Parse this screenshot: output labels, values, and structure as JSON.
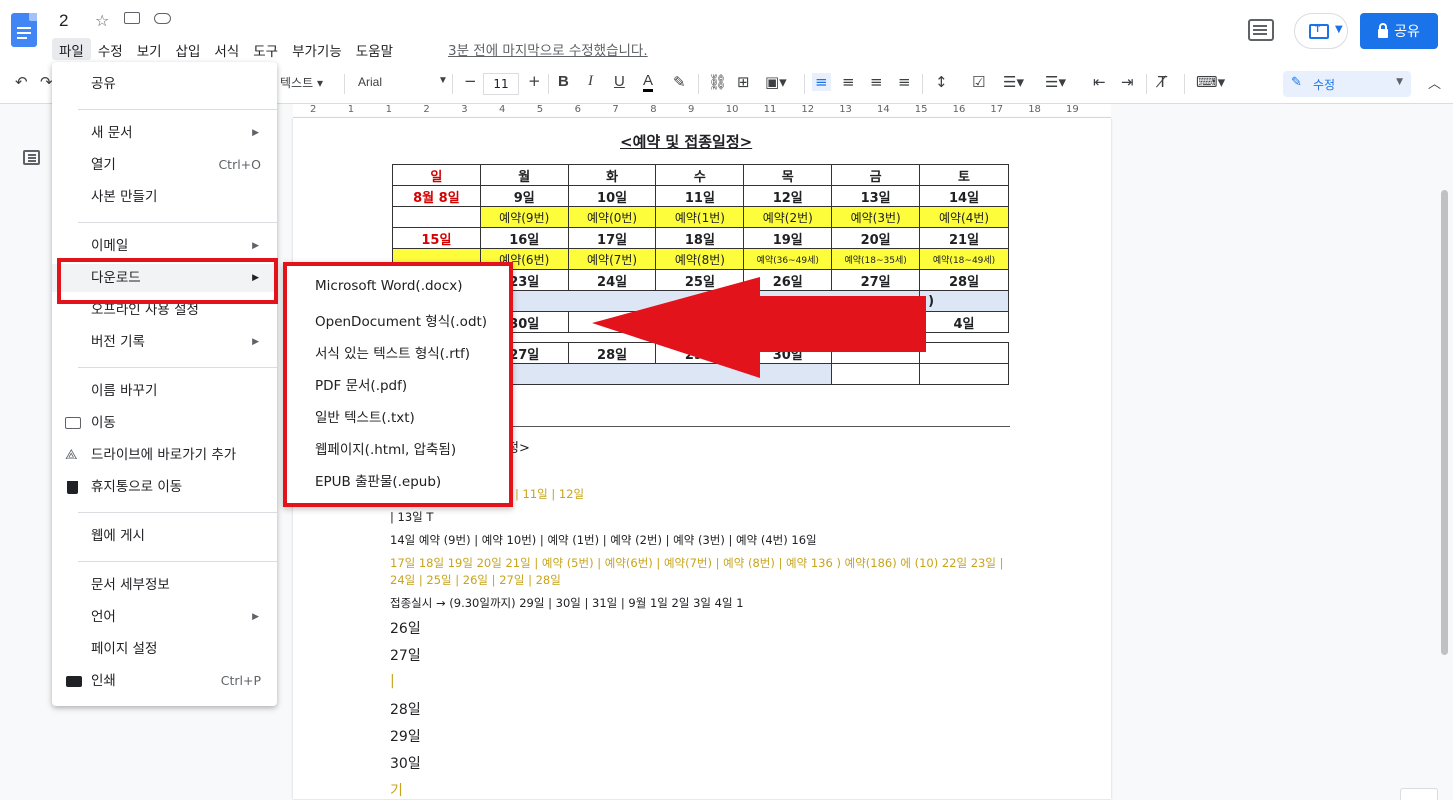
{
  "header": {
    "doc_title": "2",
    "menus": [
      "파일",
      "수정",
      "보기",
      "삽입",
      "서식",
      "도구",
      "부가기능",
      "도움말"
    ],
    "last_edit": "3분 전에 마지막으로 수정했습니다.",
    "share_label": "공유"
  },
  "toolbar": {
    "style_value": "텍스트",
    "font_value": "Arial",
    "font_size": "11",
    "mode_label": "수정"
  },
  "ruler": [
    "2",
    "1",
    "1",
    "2",
    "3",
    "4",
    "5",
    "6",
    "7",
    "8",
    "9",
    "10",
    "11",
    "12",
    "13",
    "14",
    "15",
    "16",
    "17",
    "18",
    "19"
  ],
  "file_menu": {
    "items": [
      {
        "label": "공유"
      },
      {
        "label": "새 문서"
      },
      {
        "label": "열기",
        "shortcut": "Ctrl+O"
      },
      {
        "label": "사본 만들기"
      },
      {
        "label": "이메일"
      },
      {
        "label": "다운로드"
      },
      {
        "label": "오프라인 사용 설정"
      },
      {
        "label": "버전 기록"
      },
      {
        "label": "이름 바꾸기"
      },
      {
        "label": "이동"
      },
      {
        "label": "드라이브에 바로가기 추가"
      },
      {
        "label": "휴지통으로 이동"
      },
      {
        "label": "웹에 게시"
      },
      {
        "label": "문서 세부정보"
      },
      {
        "label": "언어"
      },
      {
        "label": "페이지 설정"
      },
      {
        "label": "인쇄",
        "shortcut": "Ctrl+P"
      }
    ]
  },
  "download_menu": {
    "items": [
      "Microsoft Word(.docx)",
      "OpenDocument 형식(.odt)",
      "서식 있는 텍스트 형식(.rtf)",
      "PDF 문서(.pdf)",
      "일반 텍스트(.txt)",
      "웹페이지(.html, 압축됨)",
      "EPUB 출판물(.epub)"
    ]
  },
  "document": {
    "schedule_title": "<예약 및 접종일정>",
    "days": [
      "일",
      "월",
      "화",
      "수",
      "목",
      "금",
      "토"
    ],
    "row1": [
      "8월 8일",
      "9일",
      "10일",
      "11일",
      "12일",
      "13일",
      "14일"
    ],
    "row2": [
      "",
      "예약(9번)",
      "예약(0번)",
      "예약(1번)",
      "예약(2번)",
      "예약(3번)",
      "예약(4번)"
    ],
    "row3": [
      "15일",
      "16일",
      "17일",
      "18일",
      "19일",
      "20일",
      "21일"
    ],
    "row4": [
      "",
      "예약(6번)",
      "예약(7번)",
      "예약(8번)",
      "예약(36~49세)",
      "예약(18~35세)",
      "예약(18~49세)"
    ],
    "row5": [
      "",
      "23일",
      "24일",
      "25일",
      "26일",
      "27일",
      "28일"
    ],
    "row6_end": ")",
    "row7": [
      "",
      "30일",
      "",
      "",
      "",
      "",
      "4일"
    ],
    "row8": [
      "",
      "27일",
      "28일",
      "29일",
      "30일",
      "",
      ""
    ],
    "text_heading_tail": "정>",
    "line_olive1": "| 11일 | 12일",
    "line_13": "| 13일 T",
    "line_14": "14일 예약 (9번) | 예약 10번) | 예약 (1번) | 예약 (2번) | 예약 (3번) | 예약 (4번) 16일",
    "line_17": "17일 18일 19일 20일 21일 | 예약 (5번) | 예약(6번) | 예약(7번) | 예약 (8번) | 예약 136 ) 예약(186) 에 (10) 22일 23일 |",
    "line_24": "24일 | 25일 | 26일 | 27일 | 28일",
    "line_vax": "접종실시 → (9.30일까지) 29일 | 30일 | 31일 | 9월 1일 2일 3일 4일 1",
    "d26": "26일",
    "d27": "27일",
    "bar": "|",
    "d28": "28일",
    "d29": "29일",
    "d30": "30일",
    "gi": "기"
  },
  "colors": {
    "accent": "#1a73e8",
    "highlight_red": "#e3131b",
    "yellow_cell": "#fdfd3c",
    "blue_cell": "#dde6f5"
  }
}
